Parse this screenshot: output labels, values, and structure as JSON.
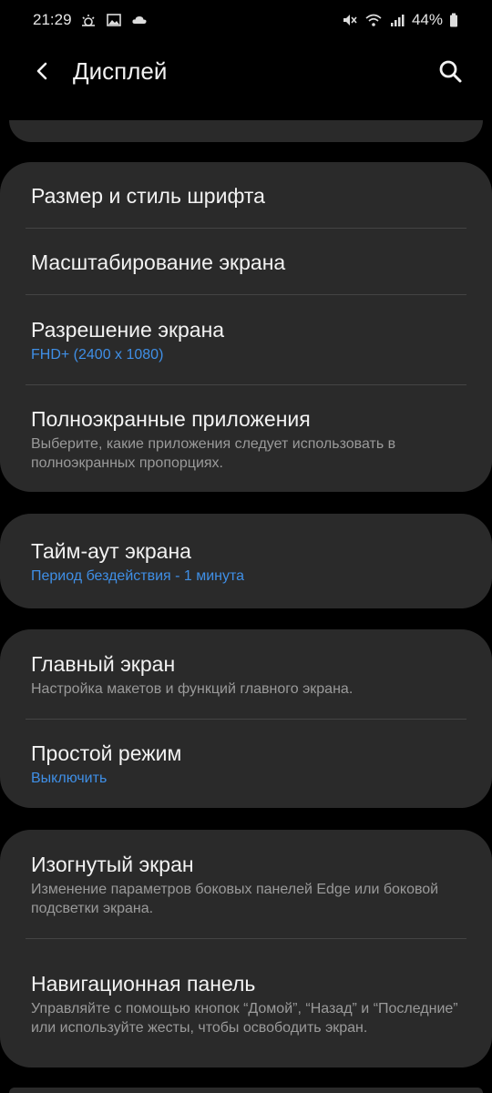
{
  "status_bar": {
    "time": "21:29",
    "battery": "44%"
  },
  "header": {
    "title": "Дисплей"
  },
  "groups": [
    {
      "items": [
        {
          "title": "Размер и стиль шрифта",
          "subtitle": ""
        },
        {
          "title": "Масштабирование экрана",
          "subtitle": ""
        },
        {
          "title": "Разрешение экрана",
          "subtitle": "FHD+ (2400 x 1080)"
        },
        {
          "title": "Полноэкранные приложения",
          "subtitle": "Выберите, какие приложения следует использовать в полноэкранных пропорциях."
        }
      ]
    },
    {
      "items": [
        {
          "title": "Тайм-аут экрана",
          "subtitle": "Период бездействия - 1 минута"
        }
      ]
    },
    {
      "items": [
        {
          "title": "Главный экран",
          "subtitle": "Настройка макетов и функций главного экрана."
        },
        {
          "title": "Простой режим",
          "subtitle": "Выключить"
        }
      ]
    },
    {
      "items": [
        {
          "title": "Изогнутый экран",
          "subtitle": "Изменение параметров боковых панелей Edge или боковой подсветки экрана."
        },
        {
          "title": "Навигационная панель",
          "subtitle": "Управляйте с помощью кнопок “Домой”, “Назад” и “Последние” или используйте жесты, чтобы освободить экран."
        }
      ]
    }
  ],
  "colors": {
    "background": "#000000",
    "card": "#2a2a2a",
    "accent_blue": "#3f8fe6",
    "secondary_text": "#9a9a9a"
  },
  "icons": [
    "back-arrow-icon",
    "search-icon",
    "weather-icon",
    "gallery-icon",
    "cloud-icon",
    "mute-icon",
    "wifi-icon",
    "signal-icon",
    "battery-icon"
  ]
}
